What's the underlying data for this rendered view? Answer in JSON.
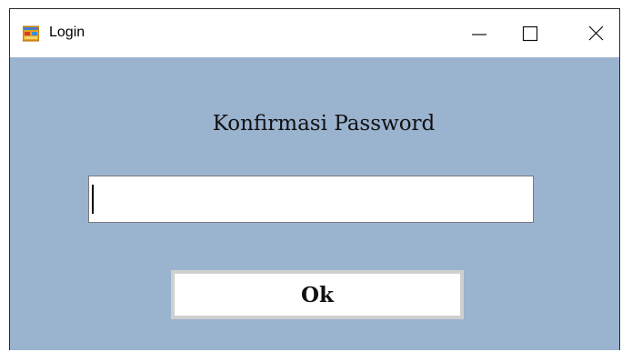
{
  "window": {
    "title": "Login",
    "icon": "windows-form-icon",
    "controls": {
      "minimize_icon": "minimize-icon",
      "maximize_icon": "maximize-icon",
      "close_icon": "close-icon"
    }
  },
  "form": {
    "heading": "Konfirmasi Password",
    "password": {
      "value": "",
      "placeholder": ""
    },
    "ok_label": "Ok"
  },
  "colors": {
    "client_background": "#9ab3cf",
    "titlebar_background": "#ffffff",
    "button_border": "#cfcfcf"
  }
}
